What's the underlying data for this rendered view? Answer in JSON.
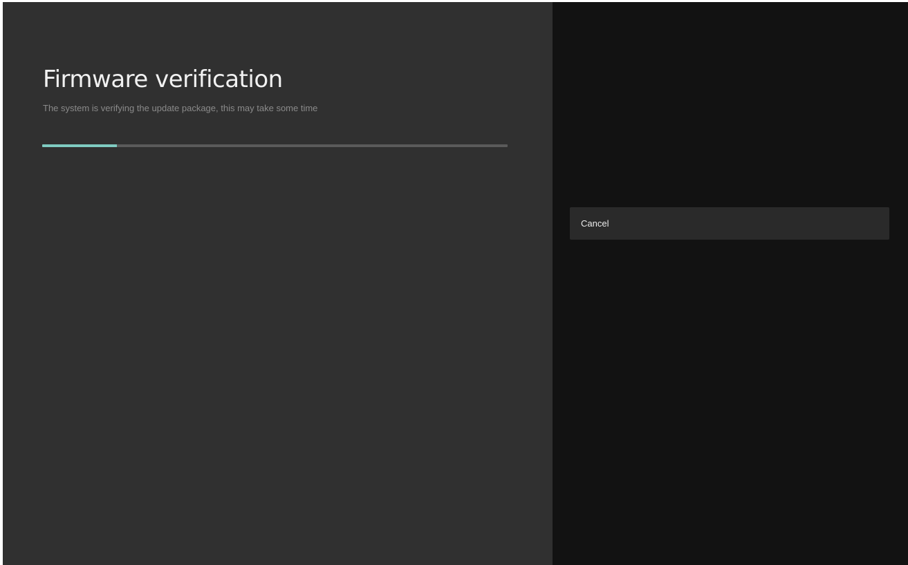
{
  "dialog": {
    "title": "Firmware verification",
    "subtitle": "The system is verifying the update package, this may take some time",
    "progress_fraction": 0.16
  },
  "actions": {
    "cancel_label": "Cancel"
  },
  "colors": {
    "left_panel_bg": "#303030",
    "right_panel_bg": "#121212",
    "progress_accent": "#7fcbc1",
    "progress_track": "#5a5a5a"
  }
}
